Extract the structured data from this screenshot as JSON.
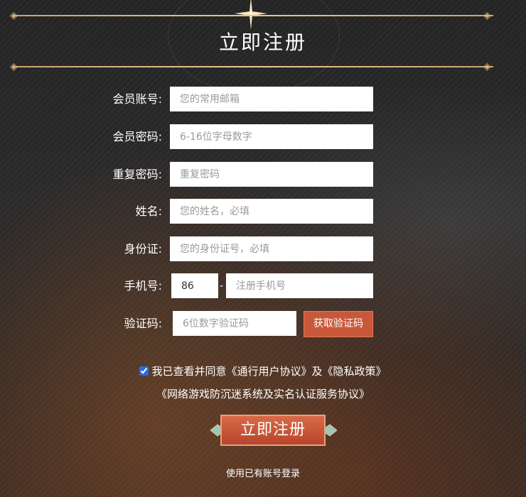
{
  "header": {
    "title": "立即注册"
  },
  "form": {
    "account": {
      "label": "会员账号:",
      "placeholder": "您的常用邮箱",
      "value": ""
    },
    "password": {
      "label": "会员密码:",
      "placeholder": "6-16位字母数字",
      "value": ""
    },
    "repeat_password": {
      "label": "重复密码:",
      "placeholder": "重复密码",
      "value": ""
    },
    "name": {
      "label": "姓名:",
      "placeholder": "您的姓名，必填",
      "value": ""
    },
    "id_card": {
      "label": "身份证:",
      "placeholder": "您的身份证号，必填",
      "value": ""
    },
    "phone": {
      "label": "手机号:",
      "country_code": "86",
      "separator": "-",
      "placeholder": "注册手机号",
      "value": ""
    },
    "code": {
      "label": "验证码:",
      "placeholder": "6位数字验证码",
      "value": "",
      "button_label": "获取验证码"
    }
  },
  "agreement": {
    "checked": true,
    "prefix": "我已查看并同意",
    "user_agreement": "《通行用户协议》",
    "conj": "及",
    "privacy": "《隐私政策》",
    "anti_addiction": "《网络游戏防沉迷系统及实名认证服务协议》"
  },
  "submit": {
    "label": "立即注册"
  },
  "footer": {
    "login_link": "使用已有账号登录"
  },
  "colors": {
    "accent": "#c9583a",
    "gold": "#d9b57e",
    "background": "#2a2a2a"
  }
}
